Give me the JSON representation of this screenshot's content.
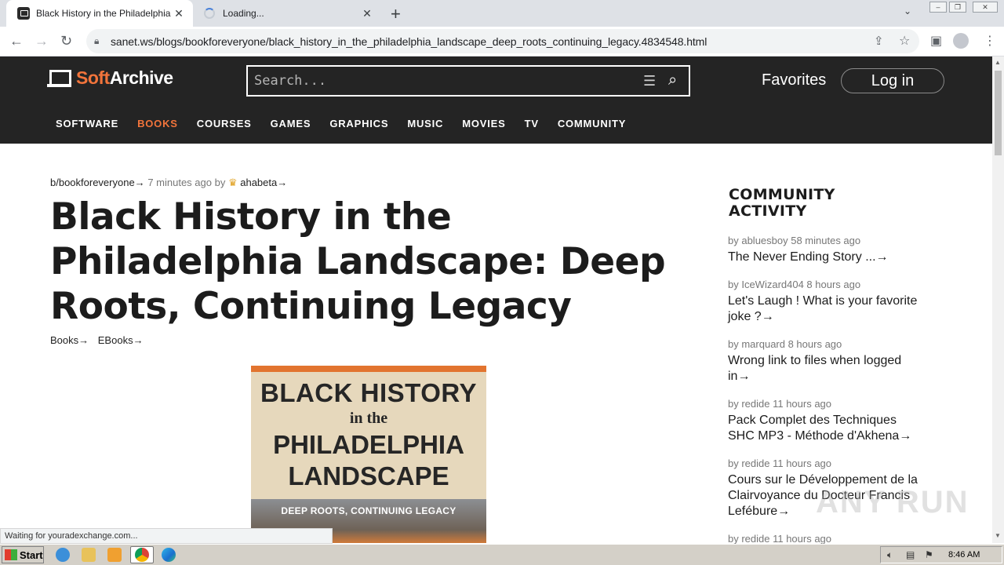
{
  "browser": {
    "tabs": [
      {
        "title": "Black History in the Philadelphia Landscape",
        "close": "✕"
      },
      {
        "title": "Loading...",
        "close": "✕"
      }
    ],
    "new_tab": "+",
    "tab_search": "⌄",
    "url": "sanet.ws/blogs/bookforeveryone/black_history_in_the_philadelphia_landscape_deep_roots_continuing_legacy.4834548.html",
    "status_text": "Waiting for youradexchange.com..."
  },
  "site": {
    "logo_soft": "Soft",
    "logo_archive": "Archive",
    "search_placeholder": "Search...",
    "favorites": "Favorites",
    "login": "Log in",
    "nav": [
      "SOFTWARE",
      "BOOKS",
      "COURSES",
      "GAMES",
      "GRAPHICS",
      "MUSIC",
      "MOVIES",
      "TV",
      "COMMUNITY"
    ],
    "active_nav": "BOOKS"
  },
  "post": {
    "blog": "b/bookforeveryone→",
    "time": "7 minutes ago by",
    "author": "ahabeta→",
    "title": "Black History in the Philadelphia Landscape: Deep Roots, Continuing Legacy",
    "categories": [
      "Books→",
      "EBooks→"
    ],
    "cover": {
      "line1": "BLACK HISTORY",
      "line2": "in the",
      "line3": "PHILADELPHIA",
      "line4": "LANDSCAPE",
      "subtitle": "DEEP ROOTS, CONTINUING LEGACY"
    }
  },
  "sidebar": {
    "title": "COMMUNITY ACTIVITY",
    "items": [
      {
        "by": "by abluesboy 58 minutes ago",
        "topic": "The Never Ending Story ...→"
      },
      {
        "by": "by IceWizard404 8 hours ago",
        "topic": "Let's Laugh ! What is your favorite joke ?→"
      },
      {
        "by": "by marquard 8 hours ago",
        "topic": "Wrong link to files when logged in→"
      },
      {
        "by": "by redide 11 hours ago",
        "topic": "Pack Complet des Techniques SHC MP3 - Méthode d'Akhena→"
      },
      {
        "by": "by redide 11 hours ago",
        "topic": "Cours sur le Développement de la Clairvoyance du Docteur Francis Lefébure→"
      },
      {
        "by": "by redide 11 hours ago",
        "topic": ""
      }
    ]
  },
  "watermark": "ANY RUN",
  "taskbar": {
    "start": "Start",
    "time": "8:46 AM"
  },
  "colors": {
    "accent": "#f2743b",
    "header_bg": "#242424"
  }
}
